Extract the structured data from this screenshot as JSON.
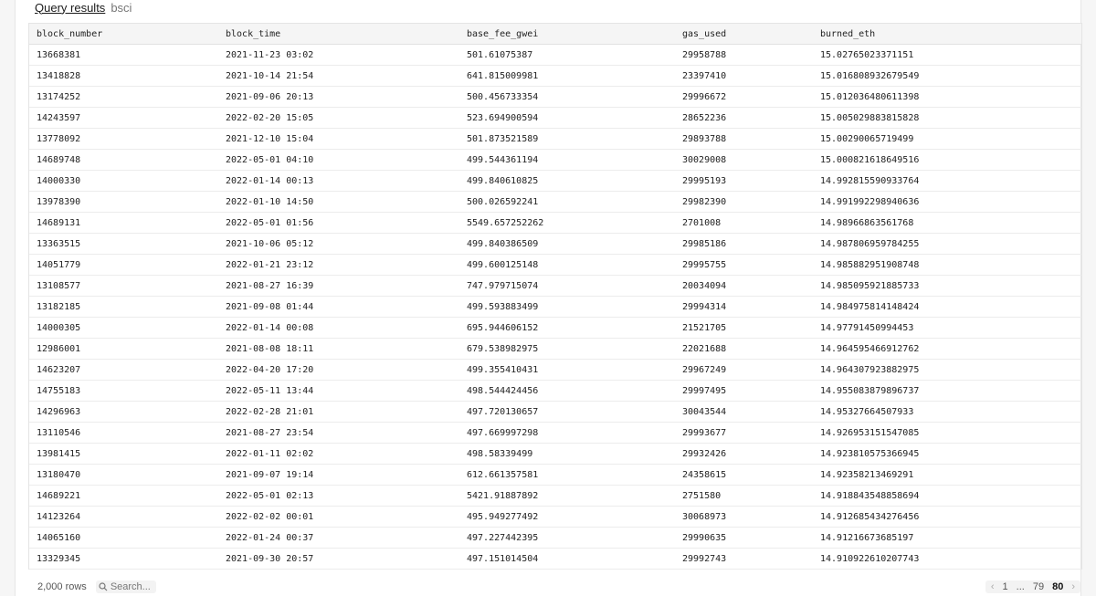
{
  "header": {
    "title": "Query results",
    "subtitle": "bsci"
  },
  "table": {
    "columns": [
      "block_number",
      "block_time",
      "base_fee_gwei",
      "gas_used",
      "burned_eth"
    ],
    "rows": [
      [
        "13668381",
        "2021-11-23 03:02",
        "501.61075387",
        "29958788",
        "15.02765023371151"
      ],
      [
        "13418828",
        "2021-10-14 21:54",
        "641.815009981",
        "23397410",
        "15.016808932679549"
      ],
      [
        "13174252",
        "2021-09-06 20:13",
        "500.456733354",
        "29996672",
        "15.012036480611398"
      ],
      [
        "14243597",
        "2022-02-20 15:05",
        "523.694900594",
        "28652236",
        "15.005029883815828"
      ],
      [
        "13778092",
        "2021-12-10 15:04",
        "501.873521589",
        "29893788",
        "15.00290065719499"
      ],
      [
        "14689748",
        "2022-05-01 04:10",
        "499.544361194",
        "30029008",
        "15.000821618649516"
      ],
      [
        "14000330",
        "2022-01-14 00:13",
        "499.840610825",
        "29995193",
        "14.992815590933764"
      ],
      [
        "13978390",
        "2022-01-10 14:50",
        "500.026592241",
        "29982390",
        "14.991992298940636"
      ],
      [
        "14689131",
        "2022-05-01 01:56",
        "5549.657252262",
        "2701008",
        "14.98966863561768"
      ],
      [
        "13363515",
        "2021-10-06 05:12",
        "499.840386509",
        "29985186",
        "14.987806959784255"
      ],
      [
        "14051779",
        "2022-01-21 23:12",
        "499.600125148",
        "29995755",
        "14.985882951908748"
      ],
      [
        "13108577",
        "2021-08-27 16:39",
        "747.979715074",
        "20034094",
        "14.985095921885733"
      ],
      [
        "13182185",
        "2021-09-08 01:44",
        "499.593883499",
        "29994314",
        "14.984975814148424"
      ],
      [
        "14000305",
        "2022-01-14 00:08",
        "695.944606152",
        "21521705",
        "14.97791450994453"
      ],
      [
        "12986001",
        "2021-08-08 18:11",
        "679.538982975",
        "22021688",
        "14.964595466912762"
      ],
      [
        "14623207",
        "2022-04-20 17:20",
        "499.355410431",
        "29967249",
        "14.964307923882975"
      ],
      [
        "14755183",
        "2022-05-11 13:44",
        "498.544424456",
        "29997495",
        "14.955083879896737"
      ],
      [
        "14296963",
        "2022-02-28 21:01",
        "497.720130657",
        "30043544",
        "14.95327664507933"
      ],
      [
        "13110546",
        "2021-08-27 23:54",
        "497.669997298",
        "29993677",
        "14.926953151547085"
      ],
      [
        "13981415",
        "2022-01-11 02:02",
        "498.58339499",
        "29932426",
        "14.923810575366945"
      ],
      [
        "13180470",
        "2021-09-07 19:14",
        "612.661357581",
        "24358615",
        "14.92358213469291"
      ],
      [
        "14689221",
        "2022-05-01 02:13",
        "5421.91887892",
        "2751580",
        "14.918843548858694"
      ],
      [
        "14123264",
        "2022-02-02 00:01",
        "495.949277492",
        "30068973",
        "14.912685434276456"
      ],
      [
        "14065160",
        "2022-01-24 00:37",
        "497.227442395",
        "29990635",
        "14.91216673685197"
      ],
      [
        "13329345",
        "2021-09-30 20:57",
        "497.151014504",
        "29992743",
        "14.910922610207743"
      ]
    ]
  },
  "footer": {
    "row_count": "2,000 rows",
    "search_placeholder": "Search...",
    "pagination": {
      "first": "1",
      "ellipsis": "...",
      "prev_page": "79",
      "current": "80"
    }
  },
  "icons": {
    "search": "search-icon",
    "prev": "chevron-left-icon",
    "next": "chevron-right-icon"
  }
}
